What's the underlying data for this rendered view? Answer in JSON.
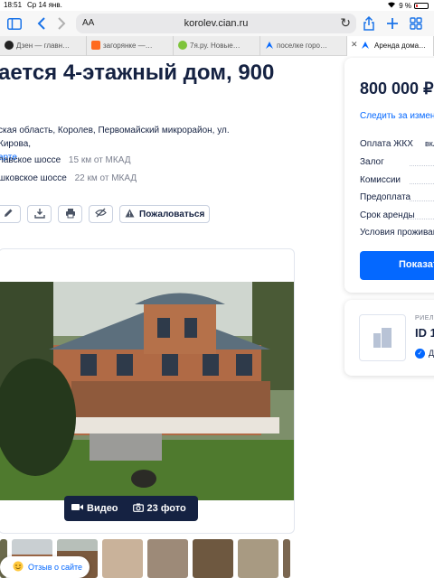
{
  "status_bar": {
    "time": "18:51",
    "date": "Ср 14 янв.",
    "battery": "9 %"
  },
  "browser": {
    "text_size_label": "AA",
    "url": "korolev.cian.ru",
    "tabs": [
      {
        "label": "Дзен — главн…",
        "icon_color": "#222222"
      },
      {
        "label": "загорянке —…",
        "icon_color": "#ff6a1f"
      },
      {
        "label": "7я.ру. Новые…",
        "icon_color": "#7ec43b"
      },
      {
        "label": "поселке горо…",
        "icon_color": "#0468ff"
      },
      {
        "label": "Аренда дома…",
        "icon_color": "#0468ff",
        "active": true
      }
    ]
  },
  "listing": {
    "title": "ается 4-этажный дом, 900",
    "address_line": "ская область, Королев, Первомайский микрорайон, ул. Кирова,",
    "map_link": "арте",
    "highways": [
      {
        "name": "лавское шоссе",
        "distance": "15 км от МКАД"
      },
      {
        "name": "шковское шоссе",
        "distance": "22 км от МКАД"
      }
    ],
    "report_label": "Пожаловаться",
    "video_label": "Видео",
    "photos_label": "23 фото",
    "review_label": "Отзыв о сайте"
  },
  "sidebar": {
    "price": "800 000 ₽",
    "follow_label": "Следить за измене",
    "conditions": [
      {
        "label": "Оплата ЖКХ",
        "value": "вкл"
      },
      {
        "label": "Залог",
        "value": ""
      },
      {
        "label": "Комиссии",
        "value": ""
      },
      {
        "label": "Предоплата",
        "value": ""
      },
      {
        "label": "Срок аренды",
        "value": ""
      },
      {
        "label": "Условия проживан",
        "value": ""
      }
    ],
    "show_button": "Показат"
  },
  "agent": {
    "role": "РИЕЛ",
    "id": "ID 1",
    "verified_text": "Д"
  },
  "colors": {
    "accent": "#0468ff",
    "dark": "#152242",
    "muted": "#7a7f8e"
  }
}
